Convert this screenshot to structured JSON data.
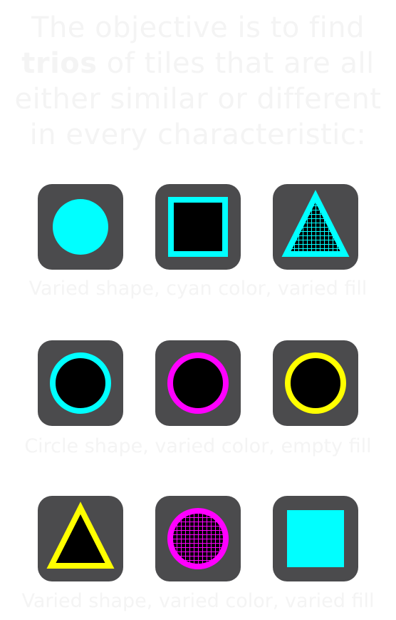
{
  "intro": {
    "line1": "The objective is to find",
    "line2_bold": "trios",
    "line2_rest": " of tiles that are all",
    "line3": "either similar or different",
    "line4": "in every characteristic:"
  },
  "colors": {
    "tile_bg": "#4b4b4d",
    "cyan": "#00ffff",
    "magenta": "#ff00ff",
    "yellow": "#ffff00",
    "empty_fill": "#000000",
    "caption_text": "#f4f4f4"
  },
  "rows": [
    {
      "caption": "Varied shape, cyan color, varied fill",
      "tiles": [
        {
          "shape": "circle",
          "color": "cyan",
          "fill": "solid"
        },
        {
          "shape": "square",
          "color": "cyan",
          "fill": "empty"
        },
        {
          "shape": "triangle",
          "color": "cyan",
          "fill": "striped"
        }
      ]
    },
    {
      "caption": "Circle shape, varied color, empty fill",
      "tiles": [
        {
          "shape": "circle",
          "color": "cyan",
          "fill": "empty"
        },
        {
          "shape": "circle",
          "color": "magenta",
          "fill": "empty"
        },
        {
          "shape": "circle",
          "color": "yellow",
          "fill": "empty"
        }
      ]
    },
    {
      "caption": "Varied shape, varied color, varied fill",
      "tiles": [
        {
          "shape": "triangle",
          "color": "yellow",
          "fill": "empty"
        },
        {
          "shape": "circle",
          "color": "magenta",
          "fill": "striped"
        },
        {
          "shape": "square",
          "color": "cyan",
          "fill": "solid"
        }
      ]
    }
  ]
}
